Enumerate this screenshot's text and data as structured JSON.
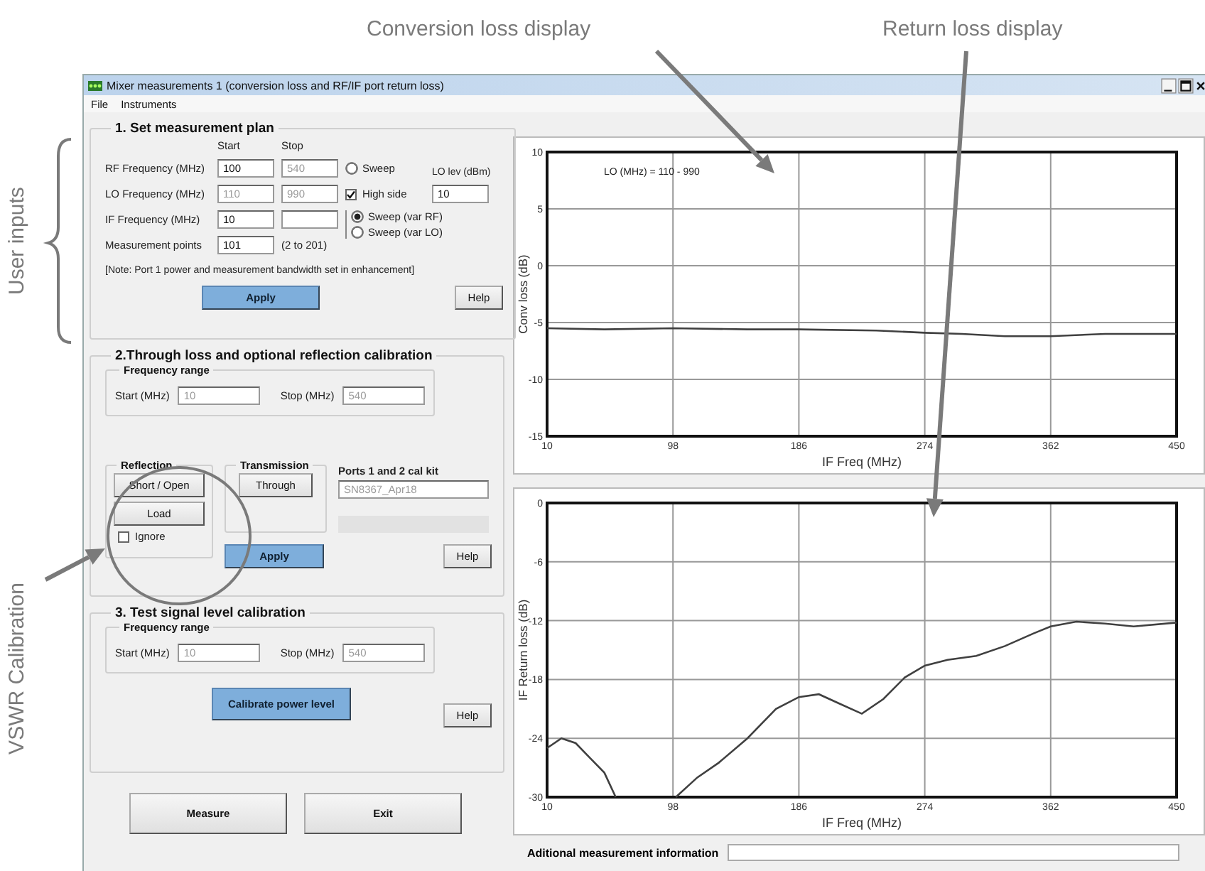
{
  "annotations": {
    "conversion_loss": "Conversion loss display",
    "return_loss": "Return loss display",
    "user_inputs": "User inputs",
    "vswr_calibration": "VSWR Calibration"
  },
  "window": {
    "title": "Mixer measurements 1 (conversion loss and RF/IF port return loss)"
  },
  "menu": [
    {
      "label": "File"
    },
    {
      "label": "Instruments"
    }
  ],
  "plan": {
    "title": "1. Set measurement plan",
    "start_heading": "Start",
    "stop_heading": "Stop",
    "rows": [
      {
        "label": "RF Frequency (MHz)",
        "start": {
          "value": "100",
          "disabled": false
        },
        "stop": {
          "value": "540",
          "disabled": true
        }
      },
      {
        "label": "LO Frequency (MHz)",
        "start": {
          "value": "110",
          "disabled": true
        },
        "stop": {
          "value": "990",
          "disabled": true
        }
      },
      {
        "label": "IF Frequency (MHz)",
        "start": {
          "value": "10",
          "disabled": false
        },
        "stop": {}
      },
      {
        "label": "Measurement points",
        "start": {
          "value": "101",
          "disabled": false
        },
        "hint": "(2 to 201)"
      }
    ],
    "sweep": {
      "label": "Sweep",
      "selected": false
    },
    "high_side": {
      "label": "High side",
      "checked": true
    },
    "lo_level": {
      "label": "LO lev (dBm)",
      "value": "10"
    },
    "sweep_mode": [
      {
        "label": "Sweep (var RF)",
        "selected": true
      },
      {
        "label": "Sweep (var LO)",
        "selected": false
      }
    ],
    "note": "[Note: Port 1 power and measurement bandwidth  set in enhancement]",
    "apply": "Apply",
    "help": "Help"
  },
  "through_cal": {
    "title": "2.Through loss and optional reflection calibration",
    "range": {
      "title": "Frequency range",
      "start_label": "Start (MHz)",
      "start": {
        "value": "10",
        "disabled": true
      },
      "stop_label": "Stop (MHz)",
      "stop": {
        "value": "540",
        "disabled": true
      }
    },
    "reflection": {
      "title": "Reflection",
      "buttons": [
        "Short / Open",
        "Load"
      ],
      "ignore": {
        "label": "Ignore",
        "checked": false
      }
    },
    "transmission": {
      "title": "Transmission",
      "button": "Through"
    },
    "cal_kit": {
      "label": "Ports 1 and 2 cal kit",
      "value": "SN8367_Apr18",
      "disabled": true
    },
    "apply": "Apply",
    "help": "Help"
  },
  "level_cal": {
    "title": "3. Test signal level calibration",
    "range": {
      "title": "Frequency range",
      "start_label": "Start (MHz)",
      "start": {
        "value": "10",
        "disabled": true
      },
      "stop_label": "Stop (MHz)",
      "stop": {
        "value": "540",
        "disabled": true
      }
    },
    "calibrate": "Calibrate power level",
    "help": "Help"
  },
  "actions": [
    "Measure",
    "Exit"
  ],
  "conversion_chart": {
    "chart_data": {
      "type": "line",
      "grid": true,
      "xlabel": "IF Freq (MHz)",
      "ylabel": "Conv loss (dB)",
      "xlim": [
        10,
        450
      ],
      "ylim": [
        -15,
        10
      ],
      "xticks": [
        10,
        98,
        186,
        274,
        362,
        450
      ],
      "yticks": [
        10,
        5,
        0,
        -5,
        -10,
        -15
      ],
      "annotations": [
        {
          "text": "LO (MHz) = 110 - 990"
        }
      ],
      "x": [
        10,
        50,
        98,
        150,
        186,
        240,
        274,
        300,
        330,
        362,
        400,
        450
      ],
      "series": [
        {
          "color": "#404040",
          "values": [
            -5.5,
            -5.6,
            -5.5,
            -5.6,
            -5.6,
            -5.7,
            -5.9,
            -6.0,
            -6.2,
            -6.2,
            -6.0,
            -6.0
          ]
        }
      ]
    }
  },
  "return_chart": {
    "chart_data": {
      "type": "line",
      "grid": true,
      "xlabel": "IF Freq (MHz)",
      "ylabel": "IF Return loss (dB)",
      "xlim": [
        10,
        450
      ],
      "ylim": [
        -30,
        0
      ],
      "xticks": [
        10,
        98,
        186,
        274,
        362,
        450
      ],
      "yticks": [
        0,
        -6,
        -12,
        -18,
        -24,
        -30
      ],
      "x": [
        10,
        20,
        30,
        40,
        50,
        58,
        79,
        100,
        115,
        130,
        150,
        170,
        186,
        200,
        215,
        230,
        245,
        260,
        274,
        290,
        310,
        330,
        350,
        362,
        380,
        400,
        420,
        450
      ],
      "series": [
        {
          "color": "#404040",
          "values": [
            -25,
            -24,
            -24.5,
            -26,
            -27.5,
            -30,
            null,
            -30,
            -28,
            -26.5,
            -24,
            -21,
            -19.8,
            -19.5,
            -20.5,
            -21.5,
            -20,
            -17.8,
            -16.6,
            -16,
            -15.6,
            -14.6,
            -13.3,
            -12.6,
            -12.1,
            -12.3,
            -12.6,
            -12.2
          ]
        }
      ]
    }
  },
  "info": {
    "label": "Aditional measurement information"
  }
}
